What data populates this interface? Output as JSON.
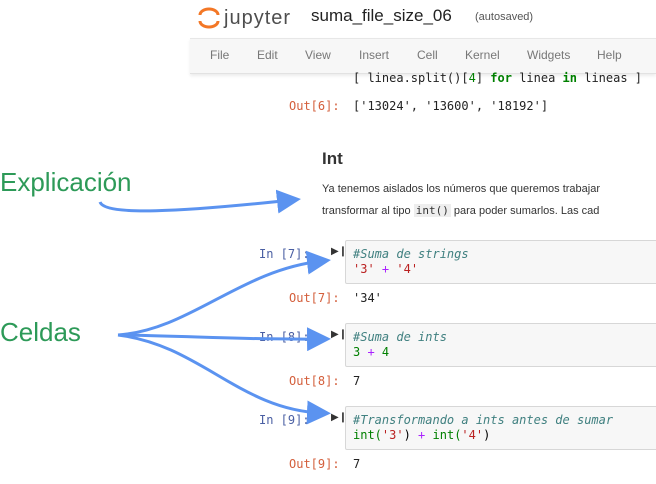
{
  "header": {
    "logo_text": "jupyter",
    "notebook_title": "suma_file_size_06",
    "autosave_status": "(autosaved)"
  },
  "menu": [
    "File",
    "Edit",
    "View",
    "Insert",
    "Cell",
    "Kernel",
    "Widgets",
    "Help"
  ],
  "cells": {
    "c6": {
      "code": {
        "open": "[ linea.split()[",
        "idx": "4",
        "mid1": "] ",
        "kw_for": "for",
        "mid2": " linea ",
        "kw_in": "in",
        "tail": " lineas ]"
      },
      "out_prompt": "Out[6]:",
      "output": "['13024', '13600', '18192']"
    },
    "markdown": {
      "heading": "Int",
      "line1": "Ya tenemos aislados los números que queremos trabajar",
      "line2_pre": "transformar al tipo ",
      "line2_code": "int()",
      "line2_post": " para poder sumarlos. Las cad"
    },
    "c7": {
      "in_prompt": "In [7]:",
      "comment": "#Suma de strings",
      "s1": "'3'",
      "op": " + ",
      "s2": "'4'",
      "out_prompt": "Out[7]:",
      "output": "'34'"
    },
    "c8": {
      "in_prompt": "In [8]:",
      "comment": "#Suma de ints",
      "n1": "3",
      "op": " + ",
      "n2": "4",
      "out_prompt": "Out[8]:",
      "output": "7"
    },
    "c9": {
      "in_prompt": "In [9]:",
      "comment": "#Transformando a ints antes de sumar",
      "f1": "int(",
      "s1": "'3'",
      "close1": ")",
      "op": " + ",
      "f2": "int(",
      "s2": "'4'",
      "close2": ")",
      "out_prompt": "Out[9]:",
      "output": "7"
    }
  },
  "annotations": {
    "explanation": "Explicación",
    "cells": "Celdas"
  },
  "colors": {
    "annotation_text": "#2d9a58",
    "arrow": "#5b93f0",
    "in_prompt": "#4a5fa3",
    "out_prompt": "#d45f3c"
  }
}
